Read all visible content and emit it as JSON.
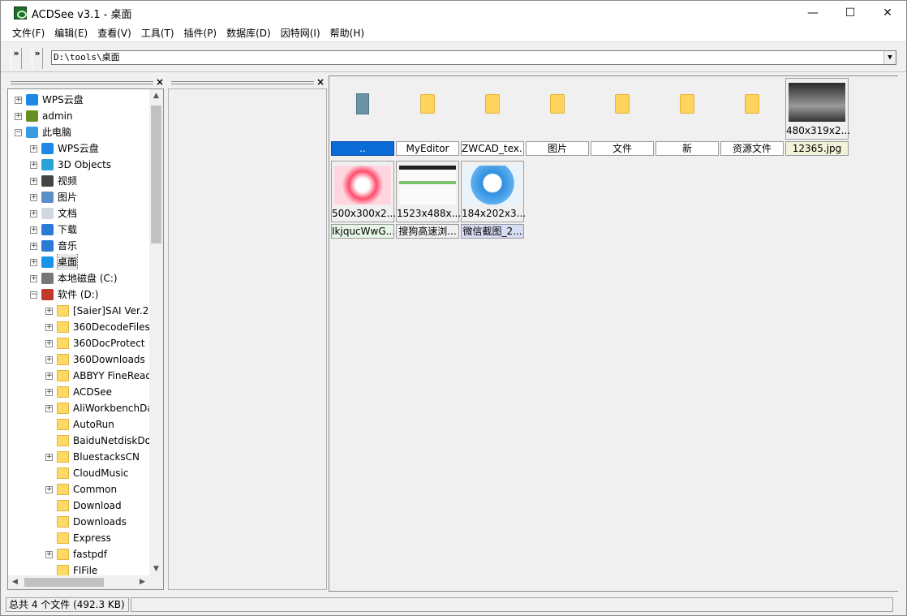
{
  "window": {
    "title": "ACDSee v3.1 - 桌面",
    "controls": {
      "minimize": "—",
      "maximize": "☐",
      "close": "✕"
    }
  },
  "menu": [
    "文件(F)",
    "编辑(E)",
    "查看(V)",
    "工具(T)",
    "插件(P)",
    "数据库(D)",
    "因特网(I)",
    "帮助(H)"
  ],
  "toolbar": {
    "chevron": "»",
    "address": "D:\\tools\\桌面",
    "dropdown": "▼"
  },
  "pane_close": "×",
  "tree": {
    "items": [
      {
        "label": "WPS云盘",
        "icon": "cloud-icon",
        "expander": "+"
      },
      {
        "label": "admin",
        "icon": "user-icon",
        "expander": "+"
      },
      {
        "label": "此电脑",
        "icon": "computer-icon",
        "expander": "−"
      },
      {
        "label": "WPS云盘",
        "icon": "cloud-icon",
        "expander": "+"
      },
      {
        "label": "3D Objects",
        "icon": "cube-icon",
        "expander": "+"
      },
      {
        "label": "视频",
        "icon": "film-icon",
        "expander": "+"
      },
      {
        "label": "图片",
        "icon": "picture-icon",
        "expander": "+"
      },
      {
        "label": "文档",
        "icon": "document-icon",
        "expander": "+"
      },
      {
        "label": "下载",
        "icon": "download-arrow-icon",
        "expander": "+"
      },
      {
        "label": "音乐",
        "icon": "music-note-icon",
        "expander": "+"
      },
      {
        "label": "桌面",
        "icon": "desktop-icon",
        "expander": "+"
      },
      {
        "label": "本地磁盘 (C:)",
        "icon": "drive-icon",
        "expander": "+"
      },
      {
        "label": "软件 (D:)",
        "icon": "drive-d-icon",
        "expander": "−"
      },
      {
        "label": "[Saier]SAI Ver.2",
        "icon": "folder-icon",
        "expander": "+"
      },
      {
        "label": "360DecodeFiles",
        "icon": "folder-icon",
        "expander": "+"
      },
      {
        "label": "360DocProtect",
        "icon": "folder-icon",
        "expander": "+"
      },
      {
        "label": "360Downloads",
        "icon": "folder-icon",
        "expander": "+"
      },
      {
        "label": "ABBYY FineReader",
        "icon": "folder-icon",
        "expander": "+"
      },
      {
        "label": "ACDSee",
        "icon": "folder-icon",
        "expander": "+"
      },
      {
        "label": "AliWorkbenchData",
        "icon": "folder-icon",
        "expander": "+"
      },
      {
        "label": "AutoRun",
        "icon": "folder-icon",
        "expander": ""
      },
      {
        "label": "BaiduNetdiskDownload",
        "icon": "folder-icon",
        "expander": ""
      },
      {
        "label": "BluestacksCN",
        "icon": "folder-icon",
        "expander": "+"
      },
      {
        "label": "CloudMusic",
        "icon": "folder-icon",
        "expander": ""
      },
      {
        "label": "Common",
        "icon": "folder-icon",
        "expander": "+"
      },
      {
        "label": "Download",
        "icon": "folder-icon",
        "expander": ""
      },
      {
        "label": "Downloads",
        "icon": "folder-icon",
        "expander": ""
      },
      {
        "label": "Express",
        "icon": "folder-icon",
        "expander": ""
      },
      {
        "label": "fastpdf",
        "icon": "folder-icon",
        "expander": "+"
      },
      {
        "label": "FlFile",
        "icon": "folder-icon",
        "expander": ""
      }
    ]
  },
  "files": [
    {
      "name": "..",
      "kind": "parent"
    },
    {
      "name": "MyEditor",
      "kind": "folder"
    },
    {
      "name": "ZWCAD_tex...",
      "kind": "folder"
    },
    {
      "name": "图片",
      "kind": "folder"
    },
    {
      "name": "文件",
      "kind": "folder"
    },
    {
      "name": "新",
      "kind": "folder"
    },
    {
      "name": "资源文件",
      "kind": "folder"
    },
    {
      "name": "12365.jpg",
      "kind": "image",
      "dims": "480x319x2..."
    },
    {
      "name": "IkjqucWwG...",
      "kind": "image",
      "dims": "500x300x2..."
    },
    {
      "name": "搜狗高速浏...",
      "kind": "image",
      "dims": "1523x488x..."
    },
    {
      "name": "微信截图_2...",
      "kind": "image",
      "dims": "184x202x3..."
    }
  ],
  "status": {
    "summary": "总共 4 个文件 (492.3 KB)"
  },
  "colors": {
    "selection": "#0a6ad6",
    "caption_tint_green": "#e6f5e6",
    "caption_tint_blue": "#d7dcf5"
  }
}
